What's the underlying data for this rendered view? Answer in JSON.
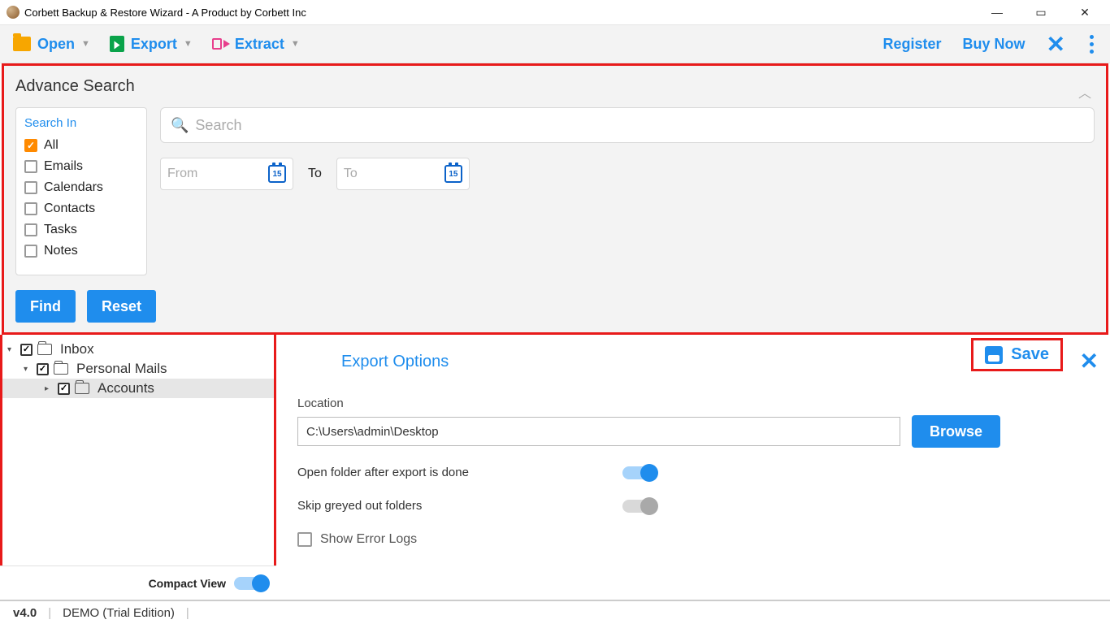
{
  "window": {
    "title": "Corbett Backup & Restore Wizard - A Product by Corbett Inc",
    "controls": {
      "min": "—",
      "max": "▭",
      "close": "✕"
    }
  },
  "toolbar": {
    "open": "Open",
    "export": "Export",
    "extract": "Extract",
    "register": "Register",
    "buy_now": "Buy Now"
  },
  "advance_search": {
    "title": "Advance Search",
    "search_in_label": "Search In",
    "items": [
      {
        "label": "All",
        "checked": true
      },
      {
        "label": "Emails",
        "checked": false
      },
      {
        "label": "Calendars",
        "checked": false
      },
      {
        "label": "Contacts",
        "checked": false
      },
      {
        "label": "Tasks",
        "checked": false
      },
      {
        "label": "Notes",
        "checked": false
      }
    ],
    "search_placeholder": "Search",
    "from_placeholder": "From",
    "to_label": "To",
    "to_placeholder": "To",
    "cal_day": "15",
    "find": "Find",
    "reset": "Reset"
  },
  "tree": {
    "items": [
      {
        "label": "Inbox",
        "checked": true,
        "indent": 0,
        "expander": "▾",
        "selected": false
      },
      {
        "label": "Personal Mails",
        "checked": true,
        "indent": 1,
        "expander": "▾",
        "selected": false
      },
      {
        "label": "Accounts",
        "checked": true,
        "indent": 2,
        "expander": "▸",
        "selected": true
      }
    ]
  },
  "export_options": {
    "title": "Export Options",
    "save": "Save",
    "location_label": "Location",
    "location_value": "C:\\Users\\admin\\Desktop",
    "browse": "Browse",
    "open_folder_label": "Open folder after export is done",
    "open_folder_on": true,
    "skip_greyed_label": "Skip greyed out folders",
    "skip_greyed_on": false,
    "show_error_logs": "Show Error Logs"
  },
  "compact_view": {
    "label": "Compact View",
    "on": true
  },
  "status": {
    "version": "v4.0",
    "edition": "DEMO (Trial Edition)"
  }
}
